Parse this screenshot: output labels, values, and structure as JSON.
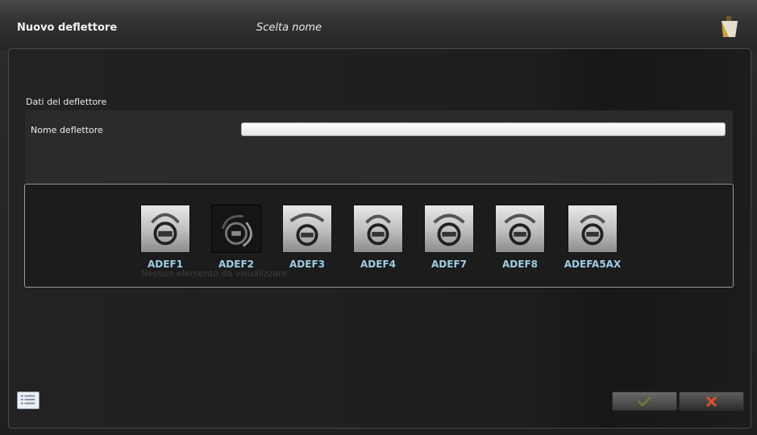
{
  "window": {
    "title": "Nuovo deflettore",
    "step": "Scelta nome"
  },
  "form": {
    "section_title": "Dati del deflettore",
    "name_label": "Nome deflettore",
    "name_value": ""
  },
  "gallery": {
    "hint": "Nessun elemento da visualizzare",
    "items": [
      {
        "label": "ADEF1",
        "selected": false
      },
      {
        "label": "ADEF2",
        "selected": true
      },
      {
        "label": "ADEF3",
        "selected": false
      },
      {
        "label": "ADEF4",
        "selected": false
      },
      {
        "label": "ADEF7",
        "selected": false
      },
      {
        "label": "ADEF8",
        "selected": false
      },
      {
        "label": "ADEFA5AX",
        "selected": false
      }
    ]
  },
  "footer": {
    "list_icon": "list-icon",
    "confirm_icon": "check-icon",
    "cancel_icon": "close-icon"
  },
  "colors": {
    "label_accent": "#9ecde4",
    "confirm": "#6b7a3a",
    "cancel": "#e1502d"
  }
}
